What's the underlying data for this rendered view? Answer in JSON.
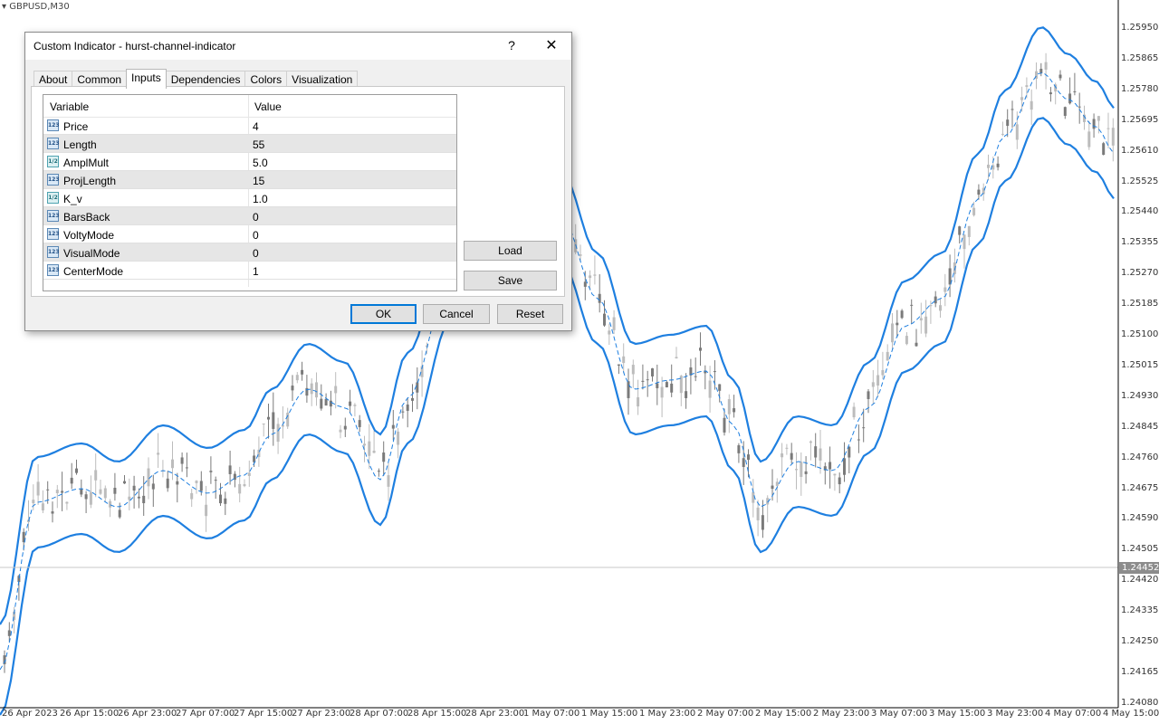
{
  "chart": {
    "symbol": "GBPUSD,M30",
    "price_ticks": [
      "1.25950",
      "1.25865",
      "1.25780",
      "1.25695",
      "1.25610",
      "1.25525",
      "1.25440",
      "1.25355",
      "1.25270",
      "1.25185",
      "1.25100",
      "1.25015",
      "1.24930",
      "1.24845",
      "1.24760",
      "1.24675",
      "1.24590",
      "1.24505",
      "1.24420",
      "1.24335",
      "1.24250",
      "1.24165",
      "1.24080"
    ],
    "current_price": "1.24452",
    "time_ticks": [
      "26 Apr 2023",
      "26 Apr 15:00",
      "26 Apr 23:00",
      "27 Apr 07:00",
      "27 Apr 15:00",
      "27 Apr 23:00",
      "28 Apr 07:00",
      "28 Apr 15:00",
      "28 Apr 23:00",
      "1 May 07:00",
      "1 May 15:00",
      "1 May 23:00",
      "2 May 07:00",
      "2 May 15:00",
      "2 May 23:00",
      "3 May 07:00",
      "3 May 15:00",
      "3 May 23:00",
      "4 May 07:00",
      "4 May 15:00"
    ],
    "colors": {
      "band": "#1e7fe0",
      "candle": "#7a7a7a",
      "candle_light": "#bcbcbc",
      "grid": "#dcdcdc"
    }
  },
  "dialog": {
    "title": "Custom Indicator - hurst-channel-indicator",
    "help_icon": "?",
    "close_icon": "✕",
    "tabs": [
      "About",
      "Common",
      "Inputs",
      "Dependencies",
      "Colors",
      "Visualization"
    ],
    "active_tab": "Inputs",
    "table": {
      "headers": {
        "variable": "Variable",
        "value": "Value"
      },
      "rows": [
        {
          "icon": "int-icon",
          "icon_text": "123",
          "name": "Price",
          "value": "4"
        },
        {
          "icon": "int-icon",
          "icon_text": "123",
          "name": "Length",
          "value": "55"
        },
        {
          "icon": "double-icon",
          "icon_text": "1/2",
          "name": "AmplMult",
          "value": "5.0"
        },
        {
          "icon": "int-icon",
          "icon_text": "123",
          "name": "ProjLength",
          "value": "15"
        },
        {
          "icon": "double-icon",
          "icon_text": "1/2",
          "name": "K_v",
          "value": "1.0"
        },
        {
          "icon": "int-icon",
          "icon_text": "123",
          "name": "BarsBack",
          "value": "0"
        },
        {
          "icon": "int-icon",
          "icon_text": "123",
          "name": "VoltyMode",
          "value": "0"
        },
        {
          "icon": "int-icon",
          "icon_text": "123",
          "name": "VisualMode",
          "value": "0"
        },
        {
          "icon": "int-icon",
          "icon_text": "123",
          "name": "CenterMode",
          "value": "1"
        }
      ]
    },
    "buttons": {
      "load": "Load",
      "save": "Save",
      "ok": "OK",
      "cancel": "Cancel",
      "reset": "Reset"
    }
  }
}
